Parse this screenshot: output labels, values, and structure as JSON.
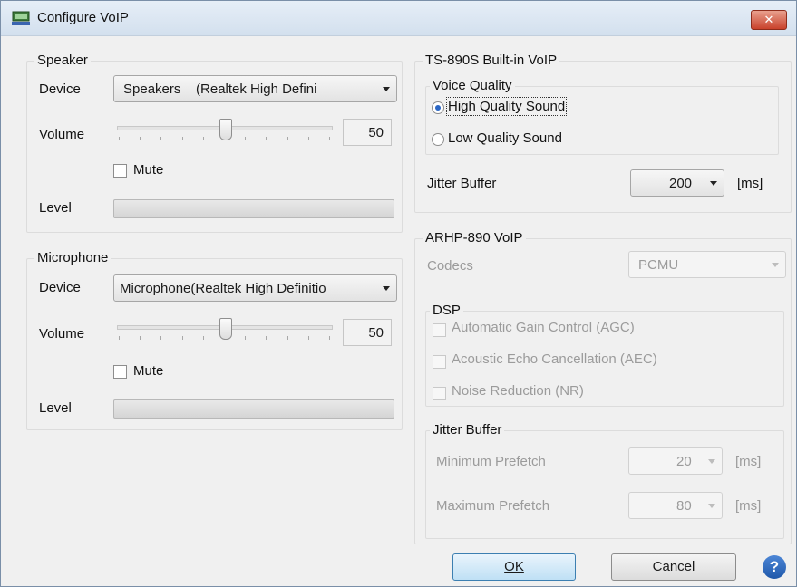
{
  "window": {
    "title": "Configure VoIP",
    "close_glyph": "✕"
  },
  "speaker": {
    "legend": "Speaker",
    "device_label": "Device",
    "device_value": "Speakers    (Realtek High Defini",
    "volume_label": "Volume",
    "volume_value": "50",
    "volume_level": 50,
    "mute_label": "Mute",
    "mute_checked": false,
    "level_label": "Level"
  },
  "microphone": {
    "legend": "Microphone",
    "device_label": "Device",
    "device_value": "Microphone(Realtek High Definitio",
    "volume_label": "Volume",
    "volume_value": "50",
    "volume_level": 50,
    "mute_label": "Mute",
    "mute_checked": false,
    "level_label": "Level"
  },
  "builtin": {
    "legend": "TS-890S Built-in VoIP",
    "voice_quality": {
      "legend": "Voice Quality",
      "options": [
        {
          "label": "High Quality Sound",
          "selected": true
        },
        {
          "label": "Low Quality Sound",
          "selected": false
        }
      ]
    },
    "jitter_label": "Jitter Buffer",
    "jitter_value": "200",
    "jitter_unit": "[ms]"
  },
  "arhp": {
    "legend": "ARHP-890 VoIP",
    "codecs_label": "Codecs",
    "codecs_value": "PCMU",
    "dsp": {
      "legend": "DSP",
      "options": [
        {
          "label": "Automatic Gain Control (AGC)",
          "checked": false
        },
        {
          "label": "Acoustic Echo Cancellation (AEC)",
          "checked": false
        },
        {
          "label": "Noise Reduction (NR)",
          "checked": false
        }
      ]
    },
    "jitter": {
      "legend": "Jitter Buffer",
      "min_label": "Minimum Prefetch",
      "min_value": "20",
      "max_label": "Maximum Prefetch",
      "max_value": "80",
      "unit": "[ms]"
    }
  },
  "buttons": {
    "ok": "OK",
    "cancel": "Cancel",
    "help": "?"
  },
  "colors": {
    "accent": "#2a66c4",
    "help": "#2a66c4",
    "close": "#c9422c"
  }
}
